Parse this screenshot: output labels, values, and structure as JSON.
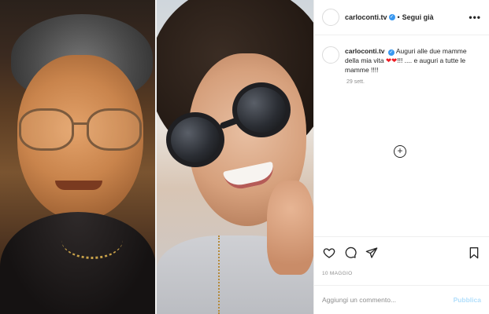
{
  "post": {
    "username": "carloconti.tv",
    "separator": "•",
    "follow_label": "Segui già",
    "more_icon": "more-horizontal-icon",
    "caption": {
      "username": "carloconti.tv",
      "text_before_hearts": "Auguri alle due mamme della mia vita ",
      "hearts": "❤❤",
      "text_after_hearts": "!!! .... e auguri a tutte le mamme !!!!"
    },
    "time_ago": "29 sett.",
    "date": "10 MAGGIO",
    "comment_placeholder": "Aggiungi un commento...",
    "publish_label": "Pubblica"
  },
  "icons": {
    "verified": "verified-badge-icon",
    "like": "heart-outline-icon",
    "comment": "comment-bubble-icon",
    "share": "paper-plane-icon",
    "save": "bookmark-icon",
    "add": "plus-circle-icon"
  },
  "colors": {
    "verified": "#3897f0",
    "heart": "#ed1c24",
    "publish": "#b2dffc"
  }
}
